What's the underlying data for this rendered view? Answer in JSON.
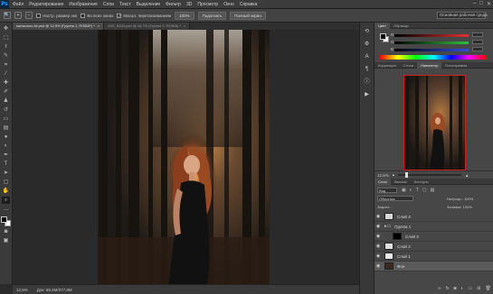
{
  "app": {
    "logo": "Ps"
  },
  "menu": [
    "Файл",
    "Редактирование",
    "Изображение",
    "Слои",
    "Текст",
    "Выделение",
    "Фильтр",
    "3D",
    "Просмотр",
    "Окно",
    "Справка"
  ],
  "window_controls": [
    "–",
    "□",
    "✕"
  ],
  "options": {
    "resize_windows": "Настр. размер окн",
    "all_windows": "Во всех окнах",
    "scrubby_zoom": "Масшт. перетаскиванием",
    "zoom_100": "100%",
    "fit_screen": "Подогнать",
    "fill_screen": "Полный экран",
    "workspace": "Основная рабочая среда"
  },
  "tabs": [
    {
      "label": "samsonov-kk.psd @ 12,5% (Группа 1, RGB/8*) *",
      "close": "×"
    },
    {
      "label": "IMG_8434.psd @ 16,7% (Группа 1, RGB/8) *",
      "close": "×"
    }
  ],
  "status": {
    "zoom": "12,5%",
    "doc": "Док: 69,4М/377,8М"
  },
  "color_panel": {
    "tabs": [
      "Цвет",
      "Образцы"
    ],
    "sliders": [
      {
        "label": "R",
        "color": "#e03030"
      },
      {
        "label": "G",
        "color": "#30c040"
      },
      {
        "label": "B",
        "color": "#3050e0"
      }
    ]
  },
  "navigator": {
    "tabs": [
      "Коррекция",
      "Стили",
      "Навигатор",
      "Гистограмма"
    ],
    "zoom": "12,5%"
  },
  "layers": {
    "tabs": [
      "Слои",
      "Каналы",
      "Контуры"
    ],
    "kind": "Вид",
    "mode": "Обычные",
    "opacity": "Непрозр.: 100%",
    "lock": "Закреп.:",
    "fill": "Заливка: 100%",
    "items": [
      {
        "name": "Слой 4"
      },
      {
        "name": "Группа 1"
      },
      {
        "name": "Слой 3"
      },
      {
        "name": "Слой 2"
      },
      {
        "name": "Слой 1"
      },
      {
        "name": "Фон"
      }
    ]
  }
}
